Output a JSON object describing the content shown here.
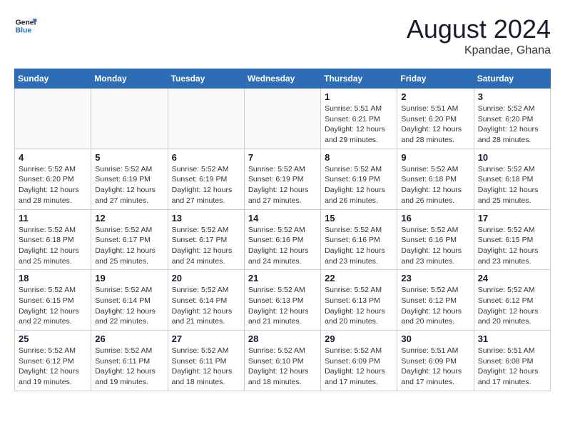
{
  "header": {
    "logo_general": "General",
    "logo_blue": "Blue",
    "month_year": "August 2024",
    "location": "Kpandae, Ghana"
  },
  "days_of_week": [
    "Sunday",
    "Monday",
    "Tuesday",
    "Wednesday",
    "Thursday",
    "Friday",
    "Saturday"
  ],
  "weeks": [
    [
      {
        "day": "",
        "info": ""
      },
      {
        "day": "",
        "info": ""
      },
      {
        "day": "",
        "info": ""
      },
      {
        "day": "",
        "info": ""
      },
      {
        "day": "1",
        "info": "Sunrise: 5:51 AM\nSunset: 6:21 PM\nDaylight: 12 hours\nand 29 minutes."
      },
      {
        "day": "2",
        "info": "Sunrise: 5:51 AM\nSunset: 6:20 PM\nDaylight: 12 hours\nand 28 minutes."
      },
      {
        "day": "3",
        "info": "Sunrise: 5:52 AM\nSunset: 6:20 PM\nDaylight: 12 hours\nand 28 minutes."
      }
    ],
    [
      {
        "day": "4",
        "info": "Sunrise: 5:52 AM\nSunset: 6:20 PM\nDaylight: 12 hours\nand 28 minutes."
      },
      {
        "day": "5",
        "info": "Sunrise: 5:52 AM\nSunset: 6:19 PM\nDaylight: 12 hours\nand 27 minutes."
      },
      {
        "day": "6",
        "info": "Sunrise: 5:52 AM\nSunset: 6:19 PM\nDaylight: 12 hours\nand 27 minutes."
      },
      {
        "day": "7",
        "info": "Sunrise: 5:52 AM\nSunset: 6:19 PM\nDaylight: 12 hours\nand 27 minutes."
      },
      {
        "day": "8",
        "info": "Sunrise: 5:52 AM\nSunset: 6:19 PM\nDaylight: 12 hours\nand 26 minutes."
      },
      {
        "day": "9",
        "info": "Sunrise: 5:52 AM\nSunset: 6:18 PM\nDaylight: 12 hours\nand 26 minutes."
      },
      {
        "day": "10",
        "info": "Sunrise: 5:52 AM\nSunset: 6:18 PM\nDaylight: 12 hours\nand 25 minutes."
      }
    ],
    [
      {
        "day": "11",
        "info": "Sunrise: 5:52 AM\nSunset: 6:18 PM\nDaylight: 12 hours\nand 25 minutes."
      },
      {
        "day": "12",
        "info": "Sunrise: 5:52 AM\nSunset: 6:17 PM\nDaylight: 12 hours\nand 25 minutes."
      },
      {
        "day": "13",
        "info": "Sunrise: 5:52 AM\nSunset: 6:17 PM\nDaylight: 12 hours\nand 24 minutes."
      },
      {
        "day": "14",
        "info": "Sunrise: 5:52 AM\nSunset: 6:16 PM\nDaylight: 12 hours\nand 24 minutes."
      },
      {
        "day": "15",
        "info": "Sunrise: 5:52 AM\nSunset: 6:16 PM\nDaylight: 12 hours\nand 23 minutes."
      },
      {
        "day": "16",
        "info": "Sunrise: 5:52 AM\nSunset: 6:16 PM\nDaylight: 12 hours\nand 23 minutes."
      },
      {
        "day": "17",
        "info": "Sunrise: 5:52 AM\nSunset: 6:15 PM\nDaylight: 12 hours\nand 23 minutes."
      }
    ],
    [
      {
        "day": "18",
        "info": "Sunrise: 5:52 AM\nSunset: 6:15 PM\nDaylight: 12 hours\nand 22 minutes."
      },
      {
        "day": "19",
        "info": "Sunrise: 5:52 AM\nSunset: 6:14 PM\nDaylight: 12 hours\nand 22 minutes."
      },
      {
        "day": "20",
        "info": "Sunrise: 5:52 AM\nSunset: 6:14 PM\nDaylight: 12 hours\nand 21 minutes."
      },
      {
        "day": "21",
        "info": "Sunrise: 5:52 AM\nSunset: 6:13 PM\nDaylight: 12 hours\nand 21 minutes."
      },
      {
        "day": "22",
        "info": "Sunrise: 5:52 AM\nSunset: 6:13 PM\nDaylight: 12 hours\nand 20 minutes."
      },
      {
        "day": "23",
        "info": "Sunrise: 5:52 AM\nSunset: 6:12 PM\nDaylight: 12 hours\nand 20 minutes."
      },
      {
        "day": "24",
        "info": "Sunrise: 5:52 AM\nSunset: 6:12 PM\nDaylight: 12 hours\nand 20 minutes."
      }
    ],
    [
      {
        "day": "25",
        "info": "Sunrise: 5:52 AM\nSunset: 6:12 PM\nDaylight: 12 hours\nand 19 minutes."
      },
      {
        "day": "26",
        "info": "Sunrise: 5:52 AM\nSunset: 6:11 PM\nDaylight: 12 hours\nand 19 minutes."
      },
      {
        "day": "27",
        "info": "Sunrise: 5:52 AM\nSunset: 6:11 PM\nDaylight: 12 hours\nand 18 minutes."
      },
      {
        "day": "28",
        "info": "Sunrise: 5:52 AM\nSunset: 6:10 PM\nDaylight: 12 hours\nand 18 minutes."
      },
      {
        "day": "29",
        "info": "Sunrise: 5:52 AM\nSunset: 6:09 PM\nDaylight: 12 hours\nand 17 minutes."
      },
      {
        "day": "30",
        "info": "Sunrise: 5:51 AM\nSunset: 6:09 PM\nDaylight: 12 hours\nand 17 minutes."
      },
      {
        "day": "31",
        "info": "Sunrise: 5:51 AM\nSunset: 6:08 PM\nDaylight: 12 hours\nand 17 minutes."
      }
    ]
  ]
}
